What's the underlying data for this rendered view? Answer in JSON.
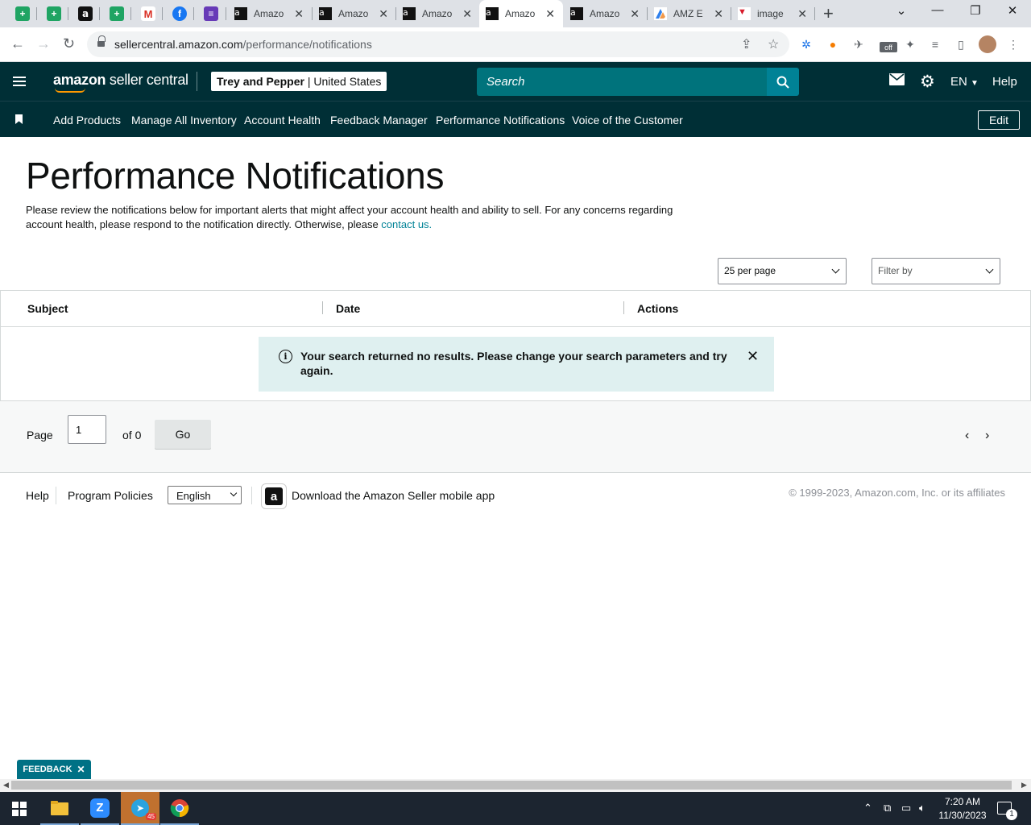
{
  "browser": {
    "tabs": [
      {
        "label": "Amazo"
      },
      {
        "label": "Amazo"
      },
      {
        "label": "Amazo"
      },
      {
        "label": "Amazo"
      },
      {
        "label": "Amazo"
      },
      {
        "label": "AMZ E"
      },
      {
        "label": "image"
      }
    ],
    "url_host": "sellercentral.amazon.com",
    "url_path": "/performance/notifications"
  },
  "header": {
    "logo_amazon": "amazon",
    "logo_seller": " seller central",
    "store_name": "Trey and Pepper",
    "store_region": "United States",
    "search_placeholder": "Search",
    "language": "EN",
    "help": "Help"
  },
  "nav": {
    "links": [
      "Add Products",
      "Manage All Inventory",
      "Account Health",
      "Feedback Manager",
      "Performance Notifications",
      "Voice of the Customer"
    ],
    "edit": "Edit"
  },
  "main": {
    "title": "Performance Notifications",
    "intro": "Please review the notifications below for important alerts that might affect your account health and ability to sell. For any concerns regarding account health, please respond to the notification directly. Otherwise, please ",
    "contact_link": "contact us.",
    "per_page": "25 per page",
    "filter_by": "Filter by",
    "columns": [
      "Subject",
      "Date",
      "Actions"
    ],
    "alert_message": "Your search returned no results. Please change your search parameters and try again."
  },
  "pager": {
    "page_label": "Page",
    "page_value": "1",
    "of_label": "of 0",
    "go": "Go"
  },
  "footer": {
    "help": "Help",
    "policies": "Program Policies",
    "language": "English",
    "download": "Download the Amazon Seller mobile app",
    "copyright": "© 1999-2023, Amazon.com, Inc. or its affiliates"
  },
  "feedback": "FEEDBACK",
  "taskbar": {
    "time": "7:20 AM",
    "date": "11/30/2023",
    "notif_count": "1",
    "telegram_badge": "45"
  }
}
